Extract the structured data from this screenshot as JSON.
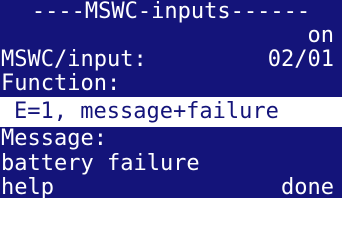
{
  "header": {
    "title": "----MSWC-inputs------"
  },
  "status": {
    "state": "on"
  },
  "input_row": {
    "label": "MSWC/input:",
    "value": "02/01"
  },
  "function": {
    "label": "Function:",
    "value": "E=1, message+failure"
  },
  "message": {
    "label": "Message:",
    "value": "battery failure"
  },
  "softkeys": {
    "left": "help",
    "right": "done"
  },
  "colors": {
    "foreground_dark": "#14147a",
    "background_light": "#ffffff"
  }
}
